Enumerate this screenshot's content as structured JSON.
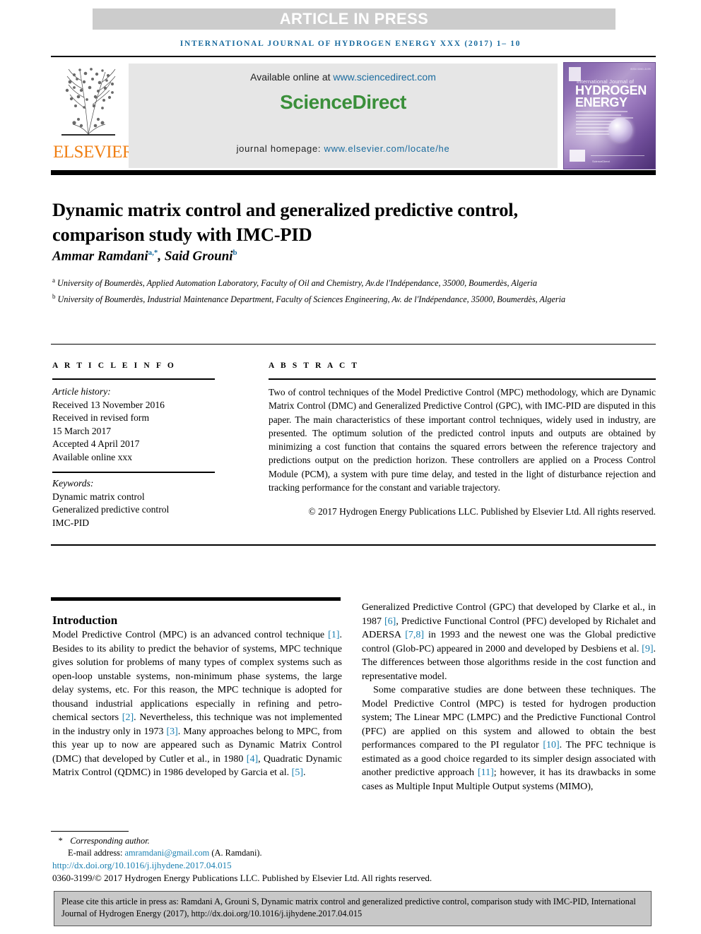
{
  "banner": {
    "article_in_press": "ARTICLE IN PRESS",
    "running_head": "INTERNATIONAL JOURNAL OF HYDROGEN ENERGY XXX (2017) 1– 10"
  },
  "masthead": {
    "available_label": "Available online at ",
    "available_url": "www.sciencedirect.com",
    "sciencedirect_part1": "Science",
    "sciencedirect_part2": "Direct",
    "homepage_label": "journal homepage: ",
    "homepage_url": "www.elsevier.com/locate/he",
    "elsevier_wordmark": "ELSEVIER",
    "accent_green": "#3a8f3a",
    "accent_blue": "#1a6b9e",
    "elsevier_orange": "#f07f13"
  },
  "cover": {
    "issn": "ISSN 0360-3199",
    "title_small": "International Journal of",
    "title_line1": "HYDROGEN",
    "title_line2": "ENERGY",
    "publisher": "ScienceDirect"
  },
  "article": {
    "title": "Dynamic matrix control and generalized predictive control, comparison study with IMC-PID",
    "authors": "Ammar Ramdani",
    "author1_sup": "a,*",
    "author2": ", Said Grouni",
    "author2_sup": "b",
    "affiliation_a_sup": "a",
    "affiliation_a": " University of Boumerdès, Applied Automation Laboratory, Faculty of Oil and Chemistry, Av.de l'Indépendance, 35000, Boumerdès, Algeria",
    "affiliation_b_sup": "b",
    "affiliation_b": " University of Boumerdès, Industrial Maintenance Department, Faculty of Sciences Engineering, Av. de l'Indépendance, 35000, Boumerdès, Algeria"
  },
  "article_info": {
    "heading": "A R T I C L E  I N F O",
    "history_label": "Article history:",
    "received": "Received 13 November 2016",
    "revised_label": "Received in revised form",
    "revised_date": "15 March 2017",
    "accepted": "Accepted 4 April 2017",
    "available_online": "Available online xxx",
    "keywords_label": "Keywords:",
    "keyword1": "Dynamic matrix control",
    "keyword2": "Generalized predictive control",
    "keyword3": "IMC-PID"
  },
  "abstract": {
    "heading": "A B S T R A C T",
    "text": "Two of control techniques of the Model Predictive Control (MPC) methodology, which are Dynamic Matrix Control (DMC) and Generalized Predictive Control (GPC), with IMC-PID are disputed in this paper. The main characteristics of these important control techniques, widely used in industry, are presented. The optimum solution of the predicted control inputs and outputs are obtained by minimizing a cost function that contains the squared errors between the reference trajectory and predictions output on the prediction horizon. These controllers are applied on a Process Control Module (PCM), a system with pure time delay, and tested in the light of disturbance rejection and tracking performance for the constant and variable trajectory.",
    "copyright": "© 2017 Hydrogen Energy Publications LLC. Published by Elsevier Ltd. All rights reserved."
  },
  "body": {
    "intro_heading": "Introduction",
    "left_paragraph_parts": {
      "p1": "Model Predictive Control (MPC) is an advanced control technique ",
      "r1": "[1]",
      "p2": ". Besides to its ability to predict the behavior of systems, MPC technique gives solution for problems of many types of complex systems such as open-loop unstable systems, non-minimum phase systems, the large delay systems, etc. For this reason, the MPC technique is adopted for thousand industrial applications especially in refining and petro-chemical sectors ",
      "r2": "[2]",
      "p3": ". Nevertheless, this technique was not implemented in the industry only in 1973 ",
      "r3": "[3]",
      "p4": ". Many approaches belong to MPC, from this year up to now are appeared such as Dynamic Matrix Control (DMC) that developed by Cutler et al., in 1980 ",
      "r4": "[4]",
      "p5": ", Quadratic Dynamic Matrix Control (QDMC) in 1986 developed by Garcia et al. ",
      "r5": "[5]",
      "p6": "."
    },
    "right_paragraph_parts": {
      "q1": "Generalized Predictive Control (GPC) that developed by Clarke et al., in 1987 ",
      "r6": "[6]",
      "q2": ", Predictive Functional Control (PFC) developed by Richalet and ADERSA ",
      "r7": "[7,8]",
      "q3": " in 1993 and the newest one was the Global predictive control (Glob-PC) appeared in 2000 and developed by Desbiens et al. ",
      "r9": "[9]",
      "q4": ". The differences between those algorithms reside in the cost function and representative model.",
      "q5": "Some comparative studies are done between these techniques. The Model Predictive Control (MPC) is tested for hydrogen production system; The Linear MPC (LMPC) and the Predictive Functional Control (PFC) are applied on this system and allowed to obtain the best performances compared to the PI regulator ",
      "r10": "[10]",
      "q6": ". The PFC technique is estimated as a good choice regarded to its simpler design associated with another predictive approach ",
      "r11": "[11]",
      "q7": "; however, it has its drawbacks in some cases as Multiple Input Multiple Output systems (MIMO),"
    }
  },
  "footer": {
    "corresponding_star": "*",
    "corresponding_label": " Corresponding author.",
    "email_label": "E-mail address: ",
    "email": "amramdani@gmail.com",
    "email_suffix": " (A. Ramdani).",
    "doi": "http://dx.doi.org/10.1016/j.ijhydene.2017.04.015",
    "issn_line": "0360-3199/© 2017 Hydrogen Energy Publications LLC. Published by Elsevier Ltd. All rights reserved."
  },
  "citation": {
    "text": "Please cite this article in press as: Ramdani A, Grouni S, Dynamic matrix control and generalized predictive control, comparison study with IMC-PID, International Journal of Hydrogen Energy (2017), http://dx.doi.org/10.1016/j.ijhydene.2017.04.015"
  }
}
